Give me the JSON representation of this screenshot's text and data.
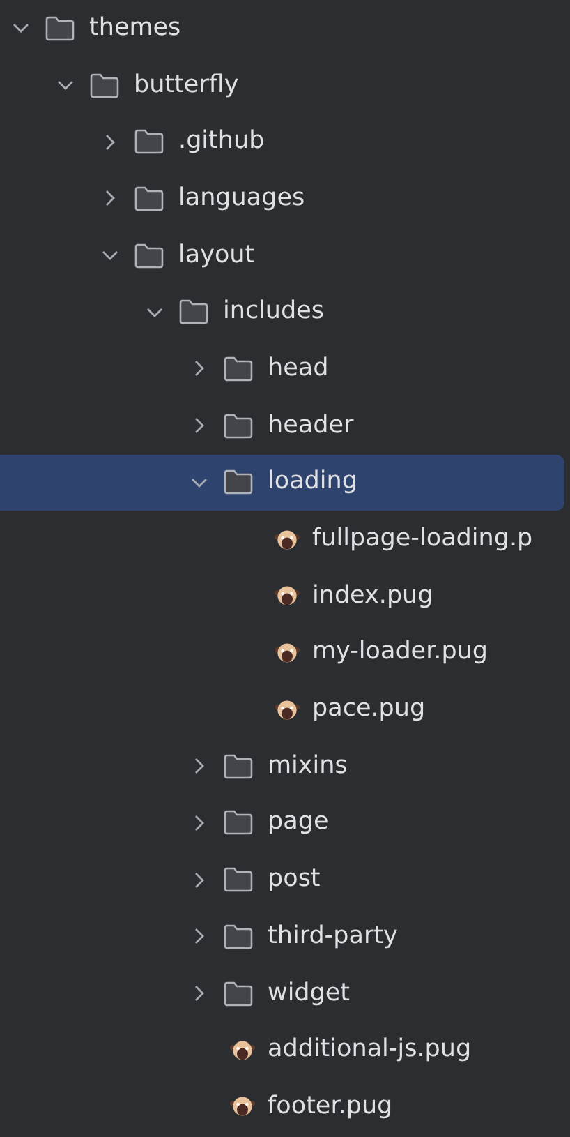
{
  "tree": [
    {
      "kind": "folder",
      "name": "themes",
      "expanded": true,
      "selected": false,
      "children": [
        {
          "kind": "folder",
          "name": "butterfly",
          "expanded": true,
          "selected": false,
          "children": [
            {
              "kind": "folder",
              "name": ".github",
              "expanded": false,
              "selected": false
            },
            {
              "kind": "folder",
              "name": "languages",
              "expanded": false,
              "selected": false
            },
            {
              "kind": "folder",
              "name": "layout",
              "expanded": true,
              "selected": false,
              "children": [
                {
                  "kind": "folder",
                  "name": "includes",
                  "expanded": true,
                  "selected": false,
                  "children": [
                    {
                      "kind": "folder",
                      "name": "head",
                      "expanded": false,
                      "selected": false
                    },
                    {
                      "kind": "folder",
                      "name": "header",
                      "expanded": false,
                      "selected": false
                    },
                    {
                      "kind": "folder",
                      "name": "loading",
                      "expanded": true,
                      "selected": true,
                      "children": [
                        {
                          "kind": "file",
                          "name": "fullpage-loading.p",
                          "selected": false
                        },
                        {
                          "kind": "file",
                          "name": "index.pug",
                          "selected": false
                        },
                        {
                          "kind": "file",
                          "name": "my-loader.pug",
                          "selected": false
                        },
                        {
                          "kind": "file",
                          "name": "pace.pug",
                          "selected": false
                        }
                      ]
                    },
                    {
                      "kind": "folder",
                      "name": "mixins",
                      "expanded": false,
                      "selected": false
                    },
                    {
                      "kind": "folder",
                      "name": "page",
                      "expanded": false,
                      "selected": false
                    },
                    {
                      "kind": "folder",
                      "name": "post",
                      "expanded": false,
                      "selected": false
                    },
                    {
                      "kind": "folder",
                      "name": "third-party",
                      "expanded": false,
                      "selected": false
                    },
                    {
                      "kind": "folder",
                      "name": "widget",
                      "expanded": false,
                      "selected": false
                    },
                    {
                      "kind": "file",
                      "name": "additional-js.pug",
                      "selected": false
                    },
                    {
                      "kind": "file",
                      "name": "footer.pug",
                      "selected": false
                    }
                  ]
                }
              ]
            }
          ]
        }
      ]
    }
  ]
}
